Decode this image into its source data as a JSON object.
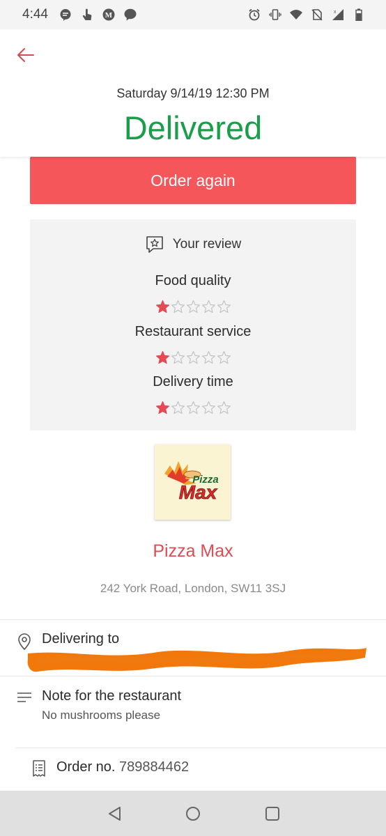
{
  "status_bar": {
    "time": "4:44",
    "left_icons": [
      "chat-bubble-icon",
      "touch-icon",
      "medium-m-icon",
      "messenger-icon"
    ],
    "right_icons": [
      "alarm-icon",
      "vibrate-icon",
      "wifi-icon",
      "no-sim-icon",
      "signal-icon",
      "battery-icon"
    ]
  },
  "header": {
    "back_icon": "arrow-left-icon",
    "date": "Saturday 9/14/19 12:30 PM",
    "status": "Delivered",
    "status_color": "#1a9e4a"
  },
  "order_again": {
    "label": "Order again",
    "color": "#f5565a"
  },
  "review": {
    "title": "Your review",
    "icon": "review-star-icon",
    "max_stars": 5,
    "ratings": [
      {
        "label": "Food quality",
        "stars": 1
      },
      {
        "label": "Restaurant service",
        "stars": 1
      },
      {
        "label": "Delivery time",
        "stars": 1
      }
    ]
  },
  "restaurant": {
    "name": "Pizza Max",
    "logo_text_top": "Pizza",
    "logo_text_bottom": "Max",
    "address": "242 York Road, London, SW11 3SJ",
    "name_color": "#de4c52"
  },
  "details": {
    "delivering_label": "Delivering to",
    "note_label": "Note for the restaurant",
    "note_text": "No mushrooms please",
    "order_no_label": "Order no.",
    "order_no": "789884462"
  },
  "nav": {
    "icons": [
      "back-triangle-icon",
      "home-circle-icon",
      "recents-square-icon"
    ]
  }
}
